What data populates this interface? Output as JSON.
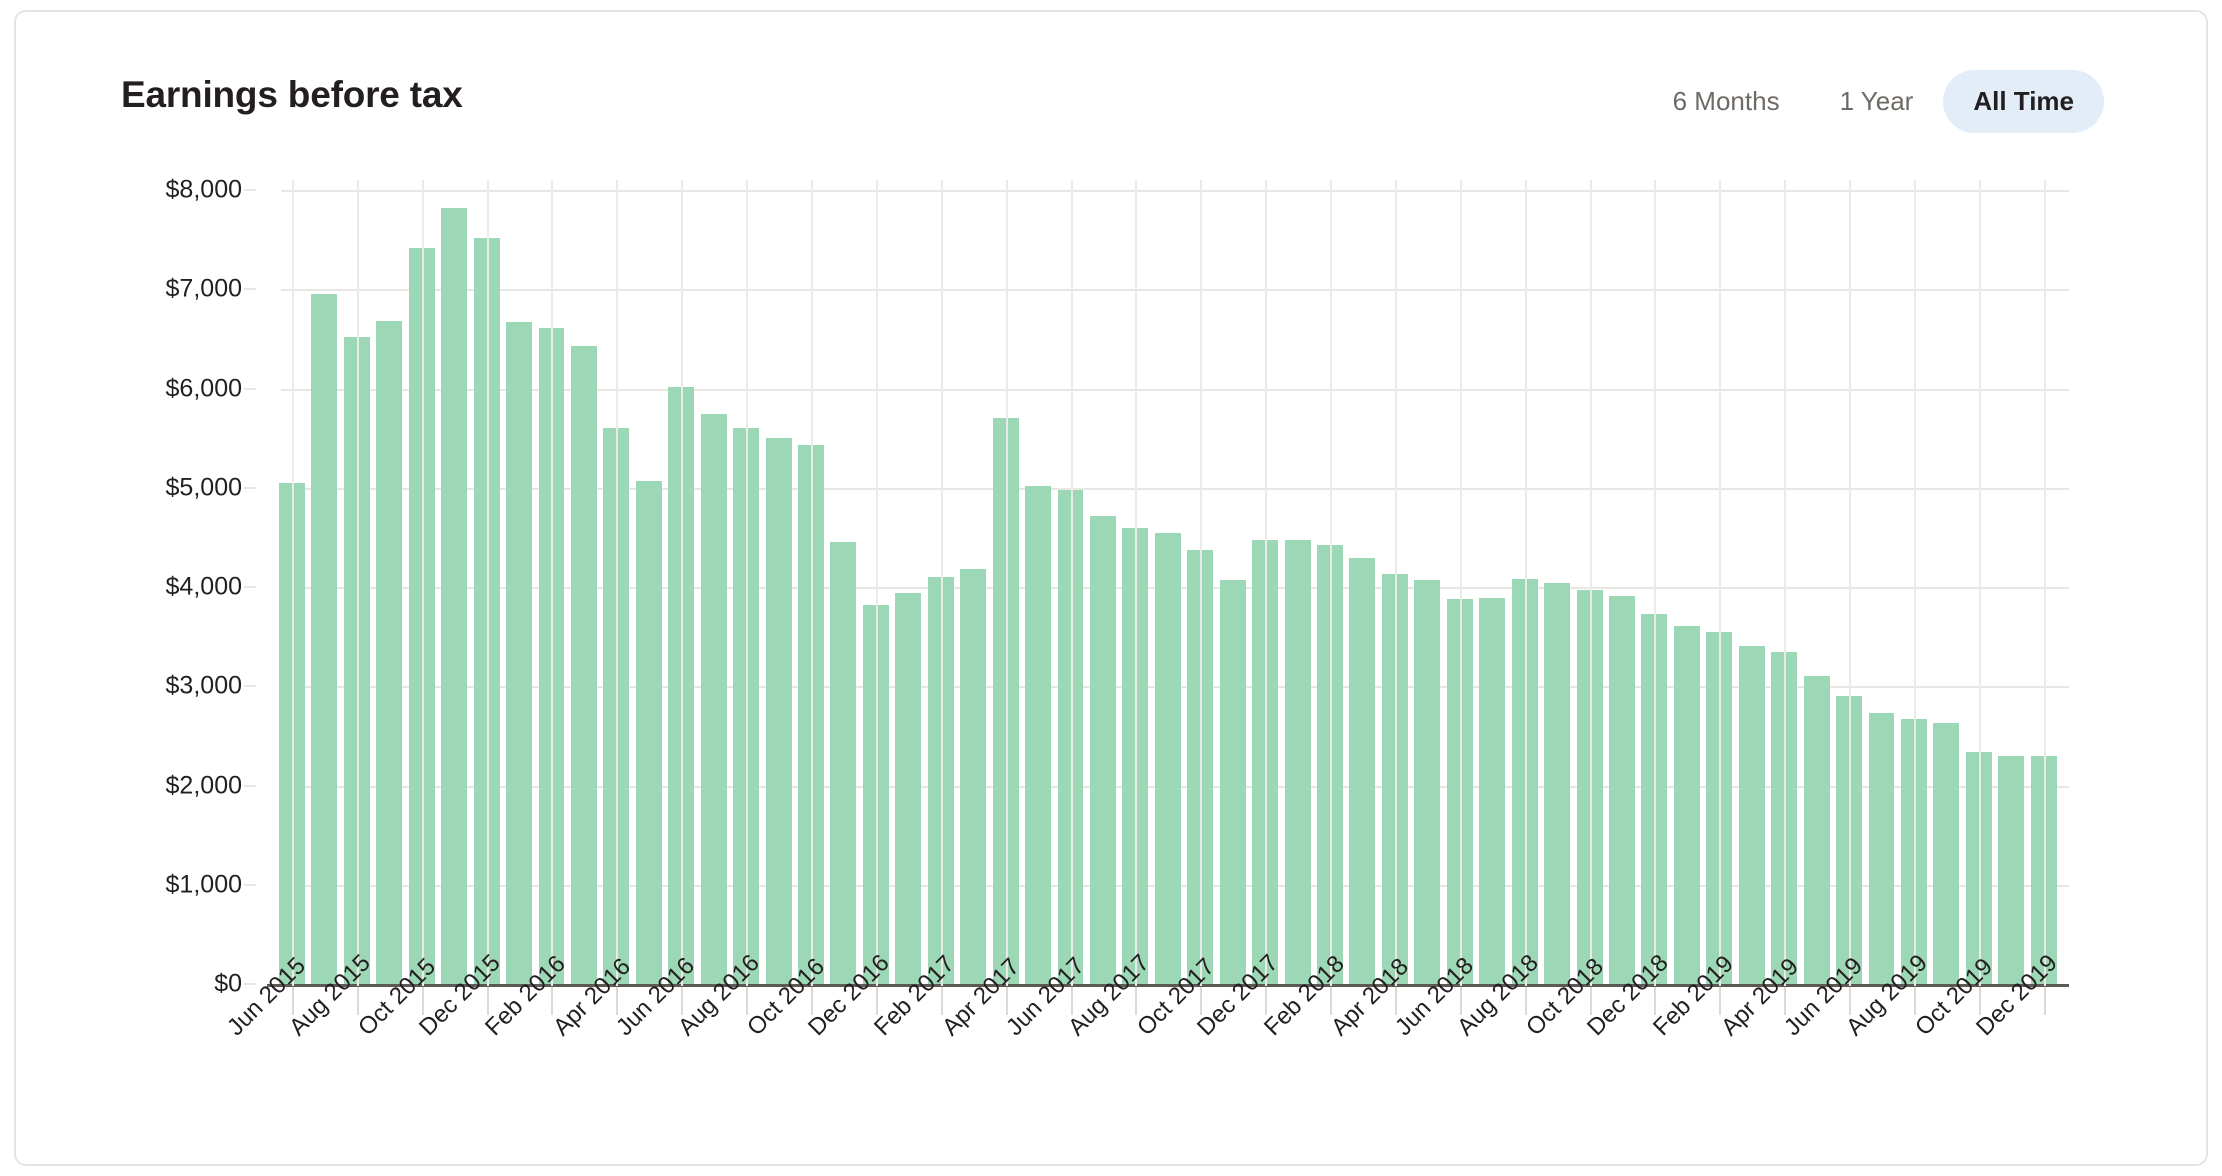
{
  "card": {
    "title": "Earnings before tax"
  },
  "range_tabs": [
    {
      "label": "6 Months",
      "active": false
    },
    {
      "label": "1 Year",
      "active": false
    },
    {
      "label": "All Time",
      "active": true
    }
  ],
  "colors": {
    "bar": "#9dd8b6",
    "active_tab_bg": "#e2edf8",
    "grid": "#e9e7e3",
    "axis": "#5d5a55",
    "text": "#231f20",
    "muted_text": "#6e6a66",
    "card_border": "#e6e4e0"
  },
  "chart_data": {
    "type": "bar",
    "title": "Earnings before tax",
    "xlabel": "",
    "ylabel": "",
    "ylim": [
      0,
      8000
    ],
    "ytick_labels": [
      "$0",
      "$1,000",
      "$2,000",
      "$3,000",
      "$4,000",
      "$5,000",
      "$6,000",
      "$7,000",
      "$8,000"
    ],
    "ytick_values": [
      0,
      1000,
      2000,
      3000,
      4000,
      5000,
      6000,
      7000,
      8000
    ],
    "grid": true,
    "legend": null,
    "xtick_labels": [
      "Jun 2015",
      "Aug 2015",
      "Oct 2015",
      "Dec 2015",
      "Feb 2016",
      "Apr 2016",
      "Jun 2016",
      "Aug 2016",
      "Oct 2016",
      "Dec 2016",
      "Feb 2017",
      "Apr 2017",
      "Jun 2017",
      "Aug 2017",
      "Oct 2017",
      "Dec 2017",
      "Feb 2018",
      "Apr 2018",
      "Jun 2018",
      "Aug 2018",
      "Oct 2018",
      "Dec 2018",
      "Feb 2019",
      "Apr 2019",
      "Jun 2019",
      "Aug 2019",
      "Oct 2019",
      "Dec 2019"
    ],
    "categories": [
      "Jun 2015",
      "Jul 2015",
      "Aug 2015",
      "Sep 2015",
      "Oct 2015",
      "Nov 2015",
      "Dec 2015",
      "Jan 2016",
      "Feb 2016",
      "Mar 2016",
      "Apr 2016",
      "May 2016",
      "Jun 2016",
      "Jul 2016",
      "Aug 2016",
      "Sep 2016",
      "Oct 2016",
      "Nov 2016",
      "Dec 2016",
      "Jan 2017",
      "Feb 2017",
      "Mar 2017",
      "Apr 2017",
      "May 2017",
      "Jun 2017",
      "Jul 2017",
      "Aug 2017",
      "Sep 2017",
      "Oct 2017",
      "Nov 2017",
      "Dec 2017",
      "Jan 2018",
      "Feb 2018",
      "Mar 2018",
      "Apr 2018",
      "May 2018",
      "Jun 2018",
      "Jul 2018",
      "Aug 2018",
      "Sep 2018",
      "Oct 2018",
      "Nov 2018",
      "Dec 2018",
      "Jan 2019",
      "Feb 2019",
      "Mar 2019",
      "Apr 2019",
      "May 2019",
      "Jun 2019",
      "Jul 2019",
      "Aug 2019",
      "Sep 2019",
      "Oct 2019",
      "Nov 2019",
      "Dec 2019"
    ],
    "values": [
      5050,
      6950,
      6520,
      6680,
      7420,
      7820,
      7520,
      6670,
      6610,
      6430,
      5600,
      5070,
      6020,
      5740,
      5600,
      5500,
      5430,
      4450,
      3820,
      3940,
      4100,
      4180,
      5700,
      5020,
      4980,
      4720,
      4590,
      4540,
      4370,
      4070,
      4470,
      4470,
      4420,
      4290,
      4130,
      4070,
      3880,
      3890,
      4080,
      4040,
      3970,
      3910,
      3730,
      3610,
      3550,
      3410,
      3350,
      3100,
      2900,
      2730,
      2670,
      2630,
      2340,
      2300,
      2300
    ]
  }
}
